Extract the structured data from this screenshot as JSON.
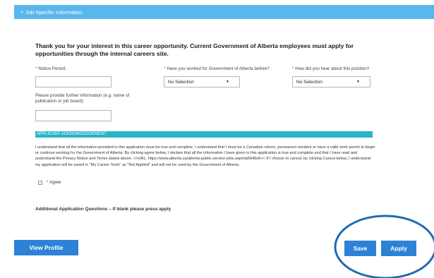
{
  "section": {
    "title": "Job-Specific Information"
  },
  "intro_text": "Thank you for your interest in this career opportunity. Current Government of Alberta employees must apply for opportunities through the internal careers site.",
  "questions": {
    "notice_period": {
      "required_mark": "*",
      "label": "Notice Period:",
      "value": ""
    },
    "worked_for_goa": {
      "required_mark": "*",
      "label": "Have you worked for Government of Alberta before?",
      "selected": "No Selection"
    },
    "hear_about": {
      "required_mark": "*",
      "label": "How did you hear about this position?",
      "selected": "No Selection"
    },
    "further_info": {
      "label": "Please provide further information (e.g. name of publication or job board):",
      "value": ""
    }
  },
  "acknowledgement": {
    "title": "APPLICANT ACKNOWLEDGEMENT",
    "text": "I understand that all the information provided in this application must be true and complete. I understand that I must be a Canadian citizen, permanent resident or have a valid work permit to begin or continue working for the Government of Alberta. By clicking agree below, I declare that all the information I have given in this application is true and complete and that I have read and understand the Privacy Notice and Terms stated above. >>URL: https://www.alberta.ca/alberta-public-service-jobs.aspx#p5646s6<< If I choose to cancel, by clicking Cancel below, I understand my application will be saved in \"My Career Tools\" as \"Not Applied\" and will not be used by the Government of Alberta.",
    "agree_required_mark": "*",
    "agree_label": "Agree"
  },
  "additional_questions": "Additional Application Questions – If blank please press apply",
  "buttons": {
    "view_profile": "View Profile",
    "save": "Save",
    "apply": "Apply"
  },
  "colors": {
    "header_bar": "#59b8eb",
    "ack_bar": "#2ab3c9",
    "button": "#2d82d6",
    "highlight_ring": "#1f6cb0",
    "required": "#e0342a"
  },
  "icons": {
    "section_toggle": "chevron-down-icon",
    "select_caret": "caret-down-icon"
  }
}
